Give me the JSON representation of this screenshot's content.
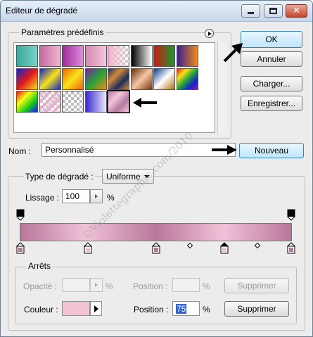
{
  "window": {
    "title": "Editeur de dégradé"
  },
  "presets": {
    "legend": "Paramètres prédéfinis",
    "swatches": [
      {
        "name": "swatch-teal",
        "bg": "linear-gradient(90deg,#3aa89b,#7ad3c8)"
      },
      {
        "name": "swatch-pink",
        "bg": "linear-gradient(90deg,#c66a9b,#f0b8d4)"
      },
      {
        "name": "swatch-violet",
        "bg": "linear-gradient(90deg,#9a2f9a,#e489e0)"
      },
      {
        "name": "swatch-rose",
        "bg": "linear-gradient(90deg,#d488b0,#f5c6dc)"
      },
      {
        "name": "swatch-pink-transparent",
        "bg": "linear-gradient(90deg,#f3b4cf,rgba(243,180,207,0)),repeating-conic-gradient(#ccc 0 25%,#fff 0 50%) 0 0/8px 8px"
      },
      {
        "name": "swatch-black-white",
        "bg": "linear-gradient(90deg,#000,#fff)"
      },
      {
        "name": "swatch-red-green",
        "bg": "linear-gradient(90deg,#d01515,#1c9a2a)"
      },
      {
        "name": "swatch-violet-orange",
        "bg": "linear-gradient(90deg,#3b1f8f,#f08a1c)"
      },
      {
        "name": "swatch-blue-red-yellow",
        "bg": "linear-gradient(135deg,#1024c8,#e21919,#f7e21a)"
      },
      {
        "name": "swatch-blue-yellow-blue",
        "bg": "linear-gradient(135deg,#1024c8,#f7e21a,#1024c8)"
      },
      {
        "name": "swatch-orange-yellow-orange",
        "bg": "linear-gradient(135deg,#f0620b,#f7e21a,#f0620b)"
      },
      {
        "name": "swatch-violet-green-orange",
        "bg": "linear-gradient(135deg,#7a1fa0,#27a33a,#f08a1c)"
      },
      {
        "name": "swatch-steel-bars",
        "bg": "linear-gradient(135deg,#1b2e5a,#d28a3c,#1b2e5a,#d28a3c)"
      },
      {
        "name": "swatch-copper",
        "bg": "linear-gradient(135deg,#6a2c0d,#f4c8a2,#7a3211)"
      },
      {
        "name": "swatch-chrome",
        "bg": "linear-gradient(135deg,#0b3c8c,#ffffff,#b07414)"
      },
      {
        "name": "swatch-spectrum",
        "bg": "linear-gradient(135deg,#e21919,#f7e21a,#27a33a,#1024c8,#8a1fa0)"
      },
      {
        "name": "swatch-transparent-rainbow",
        "bg": "linear-gradient(135deg,rgba(255,0,0,.9),rgba(255,255,0,.9),rgba(0,200,0,.9),rgba(0,0,255,.9)),repeating-conic-gradient(#ccc 0 25%,#fff 0 50%) 0 0/8px 8px"
      },
      {
        "name": "swatch-transparent-stripes",
        "bg": "repeating-linear-gradient(135deg,rgba(240,160,200,.8) 0 4px,rgba(255,255,255,0) 4px 8px),repeating-conic-gradient(#ccc 0 25%,#fff 0 50%) 0 0/8px 8px"
      },
      {
        "name": "swatch-neutral-density",
        "bg": "repeating-conic-gradient(#bbb 0 25%,#fff 0 50%) 0 0/8px 8px"
      },
      {
        "name": "swatch-blue-white",
        "bg": "linear-gradient(90deg,#3a2ad0,#e8e8ff)"
      },
      {
        "name": "swatch-custom-pink",
        "bg": "linear-gradient(135deg,#b47aa0,#f2c6da,#b47aa0,#f2c6da)"
      }
    ]
  },
  "buttons": {
    "ok": "OK",
    "cancel": "Annuler",
    "load": "Charger...",
    "save": "Enregistrer...",
    "new": "Nouveau",
    "delete_opacity": "Supprimer",
    "delete_color": "Supprimer"
  },
  "name_field": {
    "label": "Nom :",
    "value": "Personnalisé"
  },
  "gradient": {
    "type_label": "Type de dégradé :",
    "type_value": "Uniforme",
    "smooth_label": "Lissage :",
    "smooth_value": "100",
    "smooth_unit": "%",
    "bar": "linear-gradient(90deg,#b9779a 0%,#f0c2d8 24%,#b9779a 50%,#f0c2d8 75%,#b9779a 100%)",
    "watermark": "©Violettegraphic.com/2010"
  },
  "stops": {
    "legend": "Arrêts",
    "opacity_label": "Opacité :",
    "opacity_unit": "%",
    "opacity_position_label": "Position :",
    "opacity_position_unit": "%",
    "color_label": "Couleur :",
    "color_value": "#f3c2d5",
    "color_position_label": "Position :",
    "color_position_value": "75",
    "color_position_unit": "%"
  }
}
